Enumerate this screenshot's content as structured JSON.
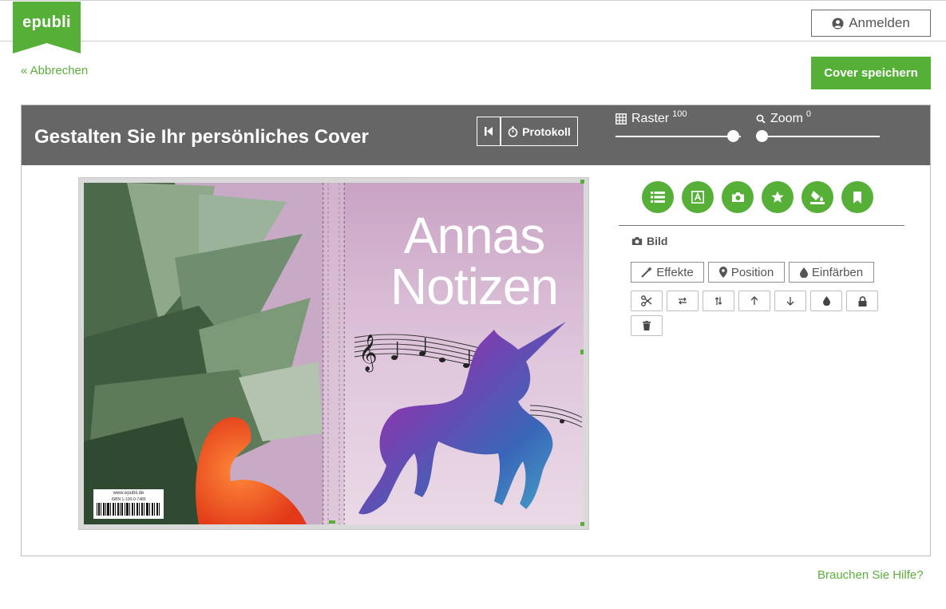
{
  "header": {
    "logo_text": "epubli",
    "login_label": "Anmelden",
    "login_icon": "user-circle-icon"
  },
  "actions": {
    "cancel_label": "« Abbrechen",
    "save_label": "Cover speichern"
  },
  "editor": {
    "title": "Gestalten Sie Ihr persönliches Cover",
    "protokoll_label": "Protokoll",
    "raster": {
      "label": "Raster",
      "value": "100"
    },
    "zoom": {
      "label": "Zoom",
      "value": "0"
    }
  },
  "cover": {
    "title_line1": "Annas",
    "title_line2": "Notizen",
    "barcode_url": "www.epubli.de",
    "barcode_isbn": "ISBN 1-100-0-7489"
  },
  "tools": {
    "circle_icons": [
      "list-icon",
      "text-icon",
      "camera-icon",
      "star-icon",
      "fill-icon",
      "bookmark-icon"
    ],
    "section_label": "Bild",
    "buttons": {
      "effekte": "Effekte",
      "position": "Position",
      "einfaerben": "Einfärben"
    },
    "small_icons": [
      "scissors-icon",
      "swap-horizontal-icon",
      "swap-vertical-icon",
      "arrow-up-icon",
      "arrow-down-icon",
      "drop-icon",
      "lock-icon",
      "trash-icon"
    ]
  },
  "footer": {
    "help_label": "Brauchen Sie Hilfe?"
  },
  "colors": {
    "brand_green": "#56b038",
    "link_green": "#5cae3b",
    "header_gray": "#666666"
  }
}
